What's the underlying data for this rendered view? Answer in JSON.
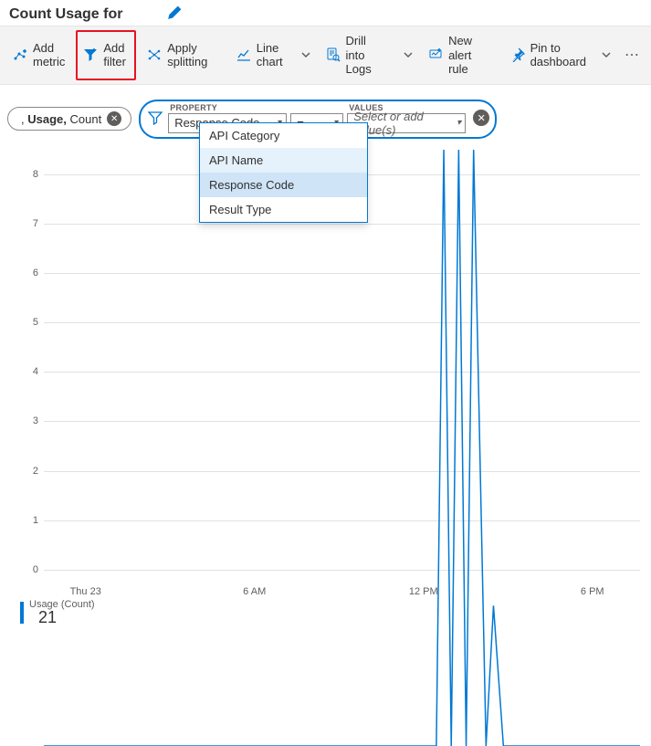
{
  "header": {
    "title": "Count Usage for"
  },
  "toolbar": {
    "add_metric": "Add metric",
    "add_filter": "Add filter",
    "apply_splitting": "Apply splitting",
    "line_chart": "Line chart",
    "drill_into_logs": "Drill into Logs",
    "new_alert_rule": "New alert rule",
    "pin_to_dashboard": "Pin to dashboard"
  },
  "metric_pill": {
    "prefix": ", ",
    "name": "Usage,",
    "agg": " Count"
  },
  "filter_builder": {
    "property_label": "PROPERTY",
    "values_label": "VALUES",
    "property_value": "Response Code",
    "operator_value": "=",
    "values_placeholder": "Select or add value(s)"
  },
  "dropdown": {
    "items": [
      {
        "label": "API Category",
        "state": ""
      },
      {
        "label": "API Name",
        "state": "hover"
      },
      {
        "label": "Response Code",
        "state": "selected"
      },
      {
        "label": "Result Type",
        "state": ""
      }
    ]
  },
  "legend": {
    "name": "Usage (Count)",
    "value": "21"
  },
  "chart_data": {
    "type": "line",
    "title": "",
    "xlabel": "",
    "ylabel": "",
    "ylim": [
      0,
      8.5
    ],
    "x_ticks": [
      "Thu 23",
      "6 AM",
      "12 PM",
      "6 PM"
    ],
    "y_ticks": [
      0,
      1,
      2,
      3,
      4,
      5,
      6,
      7,
      8
    ],
    "series": [
      {
        "name": "Usage (Count)",
        "color": "#0078d4",
        "x_hours": [
          0,
          15.8,
          16.1,
          16.4,
          16.7,
          17.0,
          17.3,
          17.8,
          18.1,
          18.5,
          24
        ],
        "values": [
          0,
          0,
          8.5,
          0,
          8.5,
          0,
          8.5,
          0,
          2,
          0,
          0
        ]
      }
    ]
  }
}
